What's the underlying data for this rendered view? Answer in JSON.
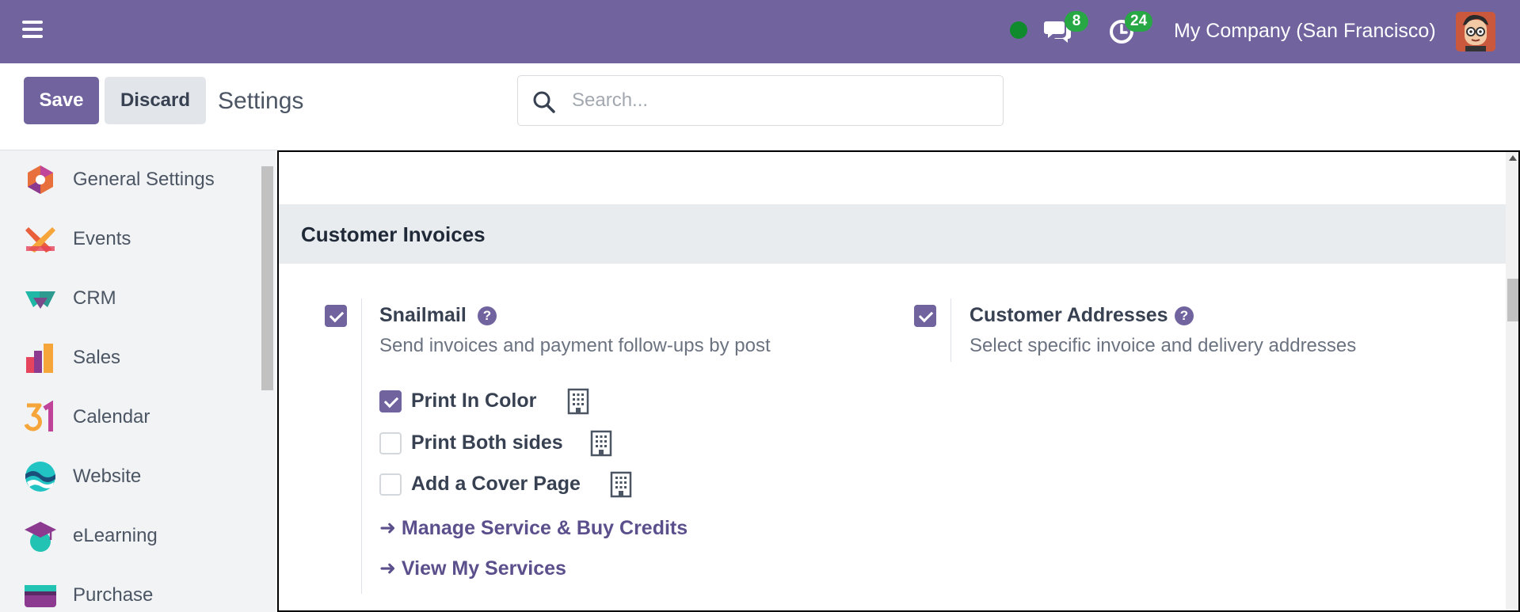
{
  "navbar": {
    "presence_color": "#0f8a2d",
    "messages_badge": "8",
    "activities_badge": "24",
    "company": "My Company (San Francisco)",
    "bg_color": "#71639e"
  },
  "control": {
    "save_label": "Save",
    "discard_label": "Discard",
    "title": "Settings",
    "search_placeholder": "Search..."
  },
  "sidebar": {
    "items": [
      {
        "label": "General Settings",
        "icon": "general-settings-icon"
      },
      {
        "label": "Events",
        "icon": "events-icon"
      },
      {
        "label": "CRM",
        "icon": "crm-icon"
      },
      {
        "label": "Sales",
        "icon": "sales-icon"
      },
      {
        "label": "Calendar",
        "icon": "calendar-icon"
      },
      {
        "label": "Website",
        "icon": "website-icon"
      },
      {
        "label": "eLearning",
        "icon": "elearning-icon"
      },
      {
        "label": "Purchase",
        "icon": "purchase-icon"
      }
    ]
  },
  "main": {
    "section_title": "Customer Invoices",
    "snailmail": {
      "checked": true,
      "title": "Snailmail",
      "description": "Send invoices and payment follow-ups by post",
      "options": [
        {
          "label": "Print In Color",
          "checked": true
        },
        {
          "label": "Print Both sides",
          "checked": false
        },
        {
          "label": "Add a Cover Page",
          "checked": false
        }
      ],
      "links": [
        "Manage Service & Buy Credits",
        "View My Services"
      ],
      "link_arrow": "➜"
    },
    "customer_addresses": {
      "checked": true,
      "title": "Customer Addresses",
      "description": "Select specific invoice and delivery addresses"
    },
    "help_glyph": "?"
  }
}
